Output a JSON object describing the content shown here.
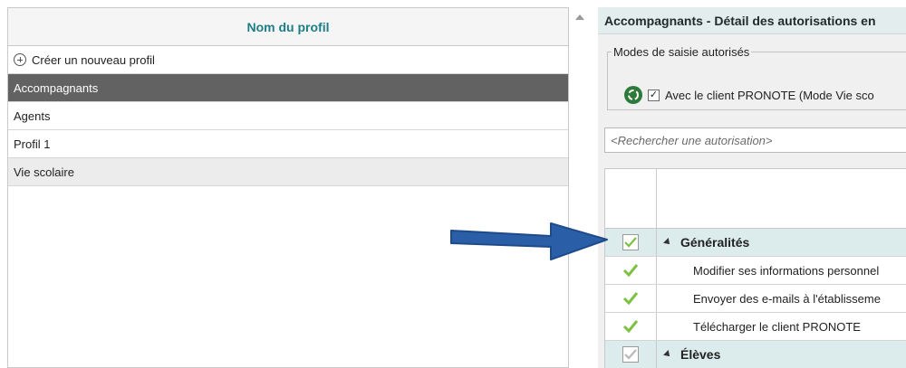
{
  "profiles": {
    "header": "Nom du profil",
    "new_profile_label": "Créer un nouveau profil",
    "items": [
      {
        "label": "Accompagnants",
        "selected": true
      },
      {
        "label": "Agents",
        "selected": false
      },
      {
        "label": "Profil 1",
        "selected": false
      },
      {
        "label": "Vie scolaire",
        "selected": false
      }
    ]
  },
  "detail": {
    "title": "Accompagnants - Détail des autorisations en",
    "modes_legend": "Modes de saisie autorisés",
    "mode_client_label": "Avec le client PRONOTE (Mode Vie sco",
    "mode_client_checked": true,
    "search_placeholder": "<Rechercher une autorisation>",
    "rows": [
      {
        "type": "group",
        "label": "Généralités",
        "checked": true
      },
      {
        "type": "item",
        "label": "Modifier ses informations personnel",
        "checked": true
      },
      {
        "type": "item",
        "label": "Envoyer des e-mails à l'établisseme",
        "checked": true
      },
      {
        "type": "item",
        "label": "Télécharger le client PRONOTE",
        "checked": true
      },
      {
        "type": "group",
        "label": "Élèves",
        "checked": "partial"
      }
    ]
  },
  "colors": {
    "accent": "#1c7d87",
    "selected_row": "#626262",
    "check_green": "#7cc142",
    "arrow_blue": "#2a5fa8"
  },
  "icons": {
    "new_profile": "plus-circle-icon",
    "app_logo": "pronote-logo-icon",
    "check": "green-check-icon",
    "expand": "triangle-down-icon",
    "annotation": "blue-arrow-icon"
  }
}
